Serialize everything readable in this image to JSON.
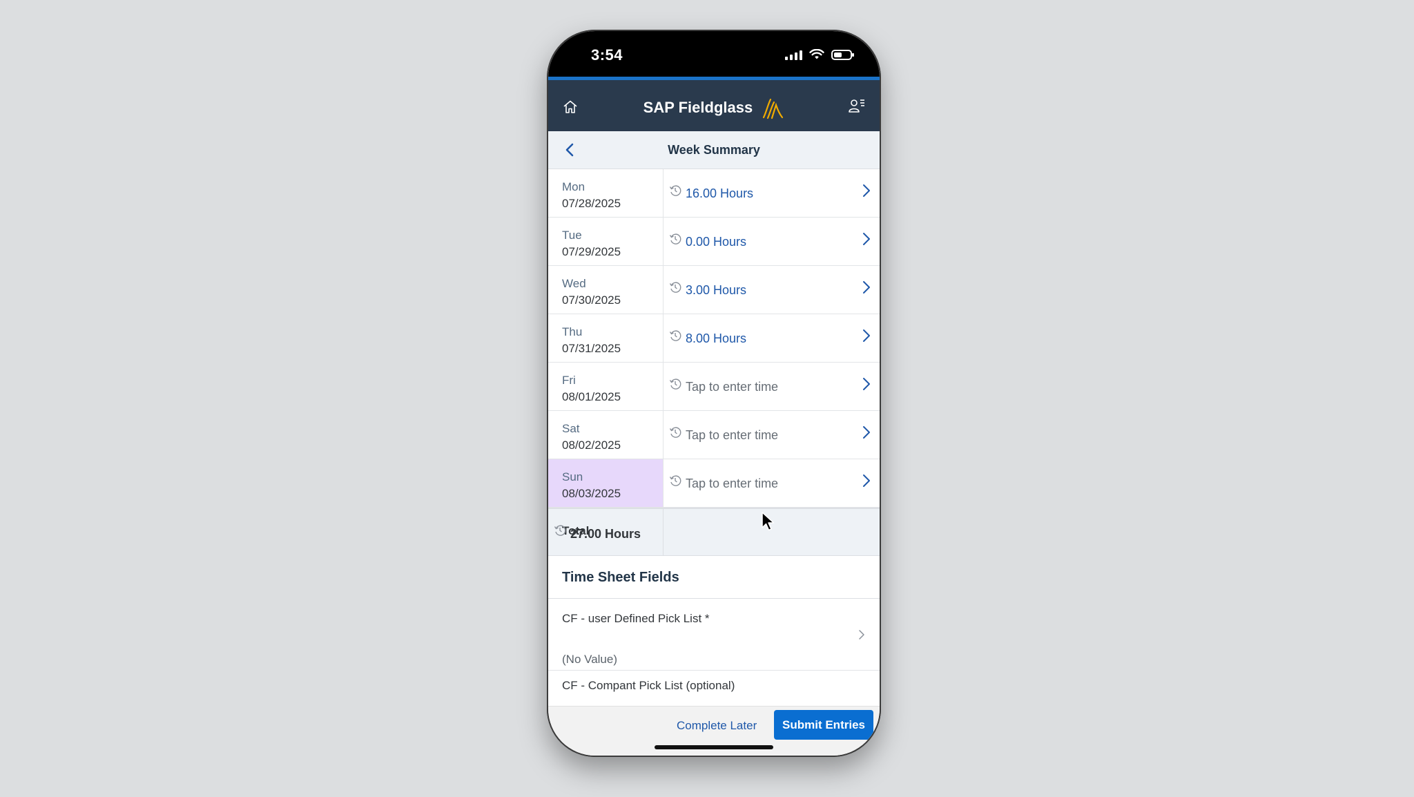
{
  "status_bar": {
    "time": "3:54"
  },
  "app_bar": {
    "brand": "SAP Fieldglass"
  },
  "header": {
    "title": "Week Summary"
  },
  "days": [
    {
      "day": "Mon",
      "date": "07/28/2025",
      "hours": "16.00 Hours",
      "filled": true,
      "selected": false
    },
    {
      "day": "Tue",
      "date": "07/29/2025",
      "hours": "0.00 Hours",
      "filled": true,
      "selected": false
    },
    {
      "day": "Wed",
      "date": "07/30/2025",
      "hours": "3.00 Hours",
      "filled": true,
      "selected": false
    },
    {
      "day": "Thu",
      "date": "07/31/2025",
      "hours": "8.00 Hours",
      "filled": true,
      "selected": false
    },
    {
      "day": "Fri",
      "date": "08/01/2025",
      "hours": "Tap to enter time",
      "filled": false,
      "selected": false
    },
    {
      "day": "Sat",
      "date": "08/02/2025",
      "hours": "Tap to enter time",
      "filled": false,
      "selected": false
    },
    {
      "day": "Sun",
      "date": "08/03/2025",
      "hours": "Tap to enter time",
      "filled": false,
      "selected": true
    }
  ],
  "total": {
    "label": "Total",
    "hours": "27.00 Hours"
  },
  "time_sheet_fields": {
    "title": "Time Sheet Fields",
    "field1_label": "CF - user Defined Pick List *",
    "field1_value": "(No Value)",
    "field2_label": "CF - Compant Pick List (optional)"
  },
  "footer": {
    "complete_later": "Complete Later",
    "submit": "Submit Entries"
  },
  "colors": {
    "app_bar": "#2a3a4d",
    "accent": "#1b73c9",
    "link": "#1f58a9",
    "selected_day": "#e7d8fb",
    "submit": "#0a6ed1"
  }
}
